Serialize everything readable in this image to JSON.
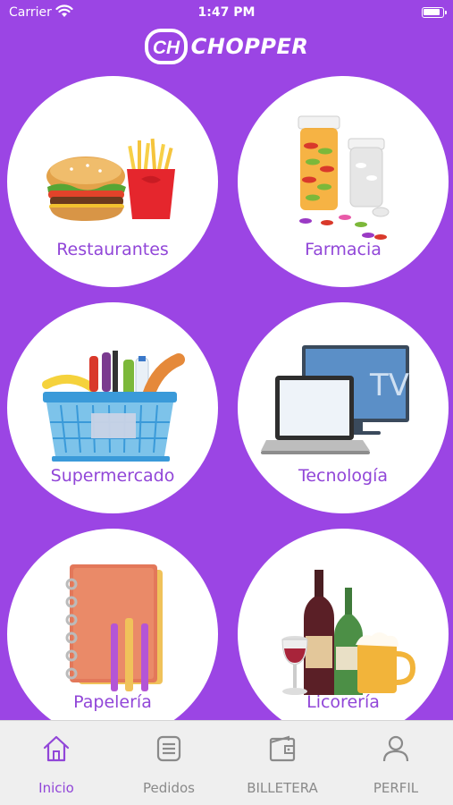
{
  "status_bar": {
    "carrier": "Carrier",
    "time": "1:47 PM"
  },
  "header": {
    "logo_mark": "CH",
    "logo_text": "CHOPPER"
  },
  "categories": [
    {
      "label": "Restaurantes",
      "icon": "burger-fries-icon"
    },
    {
      "label": "Farmacia",
      "icon": "pill-bottles-icon"
    },
    {
      "label": "Supermercado",
      "icon": "grocery-basket-icon"
    },
    {
      "label": "Tecnología",
      "icon": "laptop-tv-icon"
    },
    {
      "label": "Papelería",
      "icon": "notebook-icon"
    },
    {
      "label": "Licorería",
      "icon": "liquor-bottles-icon"
    }
  ],
  "tab_bar": {
    "active": "Inicio",
    "tabs": [
      {
        "label": "Inicio",
        "icon": "home-icon"
      },
      {
        "label": "Pedidos",
        "icon": "list-icon"
      },
      {
        "label": "BILLETERA",
        "icon": "wallet-icon"
      },
      {
        "label": "PERFIL",
        "icon": "user-icon"
      }
    ]
  },
  "colors": {
    "background": "#9b45e4",
    "accent": "#9146d8",
    "tab_bar_bg": "#efefef",
    "inactive": "#8a8a8a"
  }
}
